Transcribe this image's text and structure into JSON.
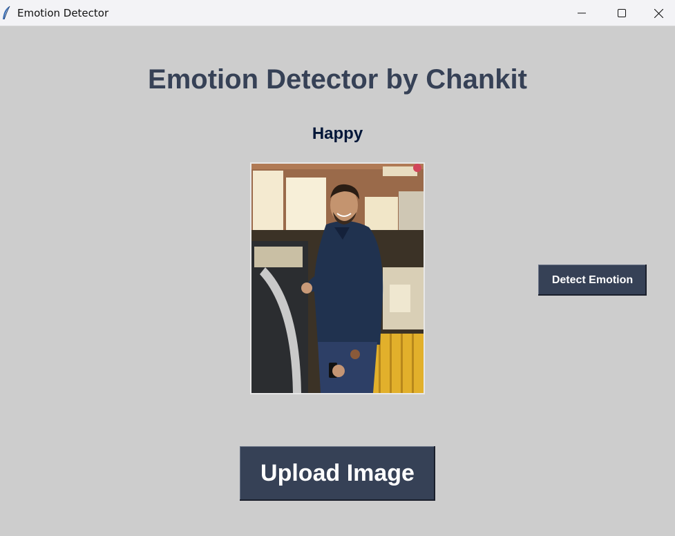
{
  "window": {
    "title": "Emotion Detector",
    "controls": {
      "minimize": "minimize-icon",
      "maximize": "maximize-icon",
      "close": "close-icon"
    }
  },
  "main": {
    "heading": "Emotion Detector by Chankit",
    "emotion_result": "Happy",
    "image_description": "uploaded-photo",
    "detect_button_label": "Detect Emotion",
    "upload_button_label": "Upload Image"
  },
  "colors": {
    "background": "#cdcdcd",
    "heading": "#364156",
    "result": "#011638",
    "button_bg": "#364156",
    "button_text": "#ffffff"
  }
}
